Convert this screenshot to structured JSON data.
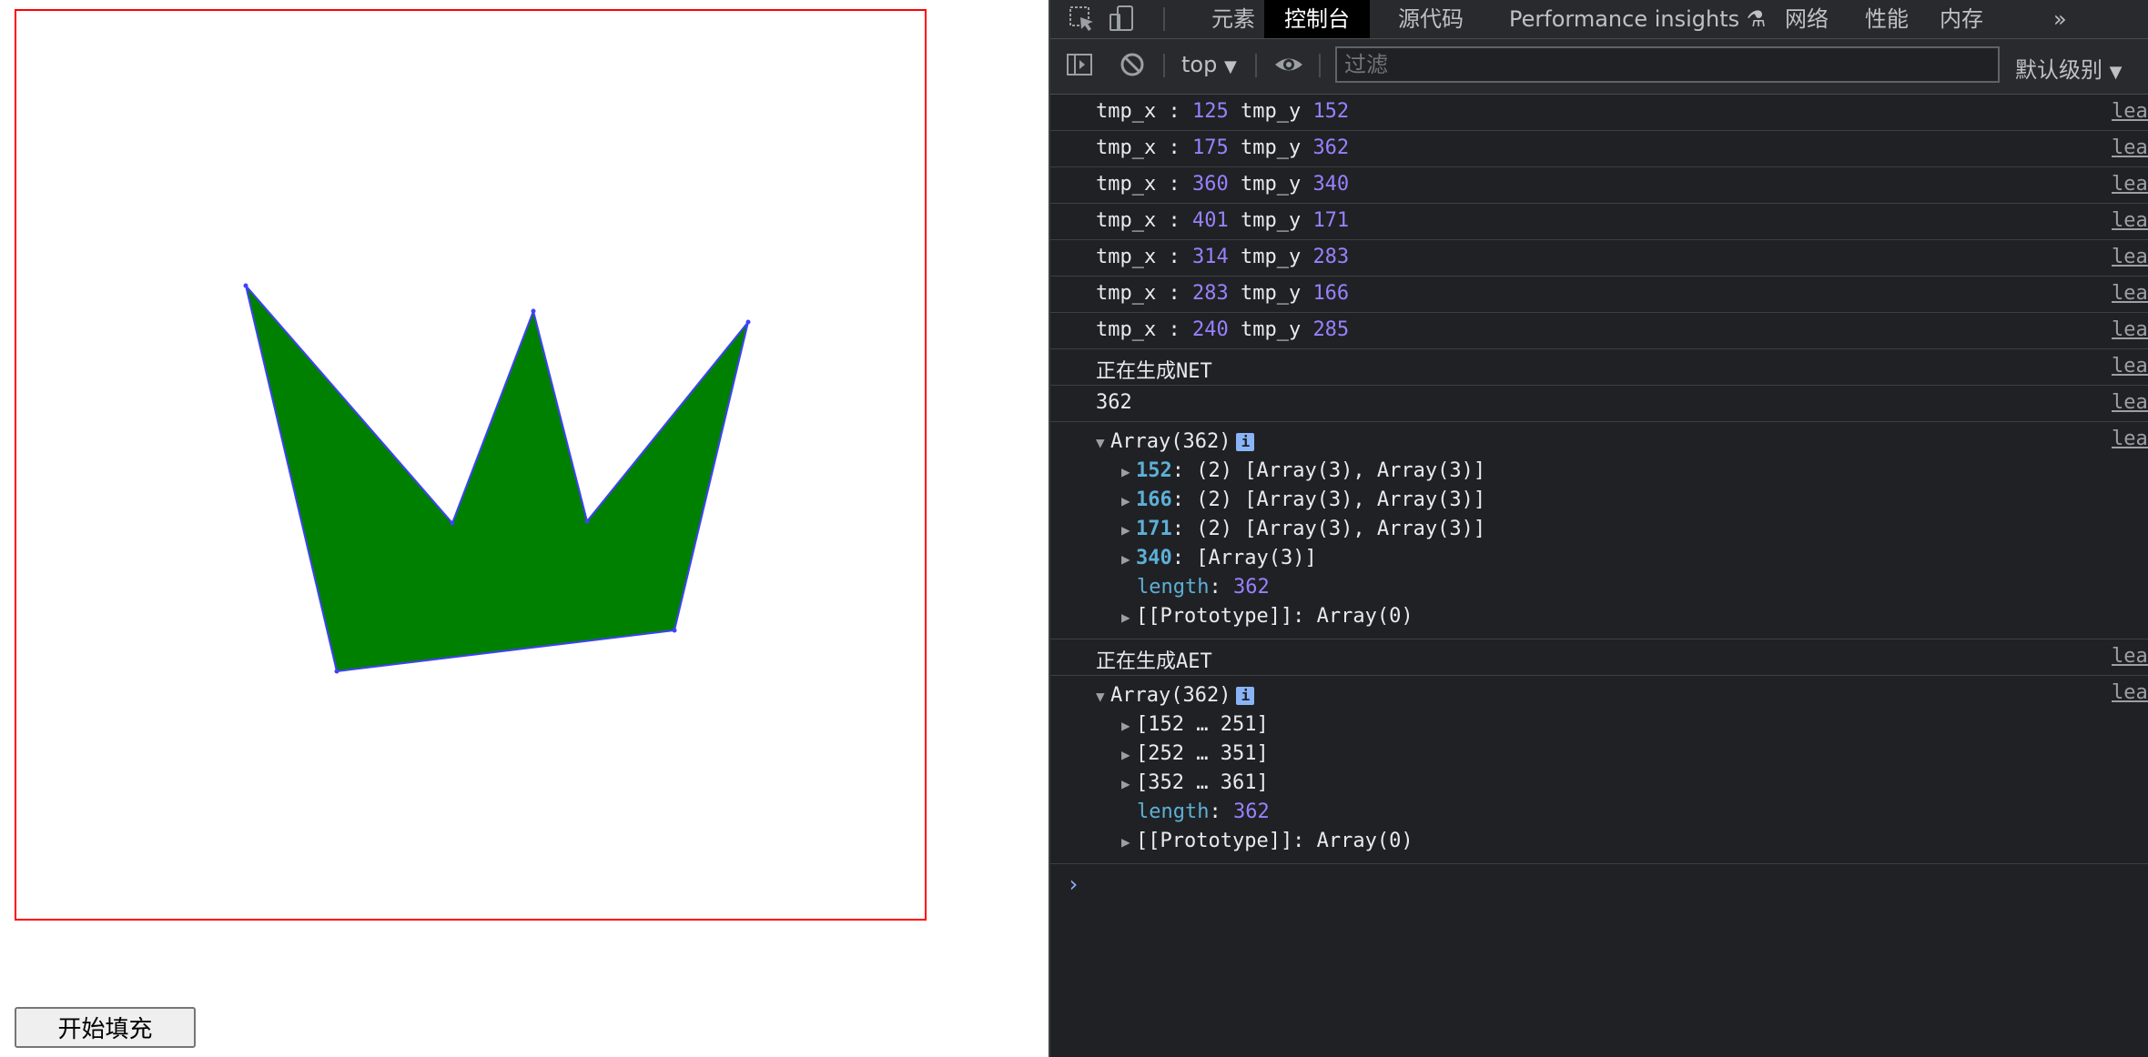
{
  "page": {
    "fill_button_label": "开始填充",
    "polygon": {
      "fill_color": "#008000",
      "stroke_color": "#4040ff",
      "border_color": "#ff0000"
    }
  },
  "devtools": {
    "tabs": [
      {
        "label": "元素",
        "active": false
      },
      {
        "label": "控制台",
        "active": true
      },
      {
        "label": "源代码",
        "active": false
      },
      {
        "label": "Performance insights",
        "active": false
      },
      {
        "label": "网络",
        "active": false
      },
      {
        "label": "性能",
        "active": false
      },
      {
        "label": "内存",
        "active": false
      }
    ],
    "more_tabs": "»",
    "toolbar": {
      "context": "top",
      "filter_placeholder": "过滤",
      "levels": "默认级别"
    },
    "source_link": "leara",
    "logs": [
      {
        "label": "tmp_x : ",
        "x": "125",
        "mid": " tmp_y ",
        "y": "152"
      },
      {
        "label": "tmp_x : ",
        "x": "175",
        "mid": " tmp_y ",
        "y": "362"
      },
      {
        "label": "tmp_x : ",
        "x": "360",
        "mid": " tmp_y ",
        "y": "340"
      },
      {
        "label": "tmp_x : ",
        "x": "401",
        "mid": " tmp_y ",
        "y": "171"
      },
      {
        "label": "tmp_x : ",
        "x": "314",
        "mid": " tmp_y ",
        "y": "283"
      },
      {
        "label": "tmp_x : ",
        "x": "283",
        "mid": " tmp_y ",
        "y": "166"
      },
      {
        "label": "tmp_x : ",
        "x": "240",
        "mid": " tmp_y ",
        "y": "285"
      }
    ],
    "net_msg": "正在生成NET",
    "net_count": "362",
    "net_array": {
      "header": "Array(362)",
      "entries": [
        {
          "key": "152",
          "value": ": (2) [Array(3), Array(3)]"
        },
        {
          "key": "166",
          "value": ": (2) [Array(3), Array(3)]"
        },
        {
          "key": "171",
          "value": ": (2) [Array(3), Array(3)]"
        },
        {
          "key": "340",
          "value": ": [Array(3)]"
        }
      ],
      "length_key": "length",
      "length_value": "362",
      "proto": "[[Prototype]]: Array(0)"
    },
    "aet_msg": "正在生成AET",
    "aet_array": {
      "header": "Array(362)",
      "ranges": [
        "[152 … 251]",
        "[252 … 351]",
        "[352 … 361]"
      ],
      "length_key": "length",
      "length_value": "362",
      "proto": "[[Prototype]]: Array(0)"
    },
    "prompt_symbol": "›"
  }
}
